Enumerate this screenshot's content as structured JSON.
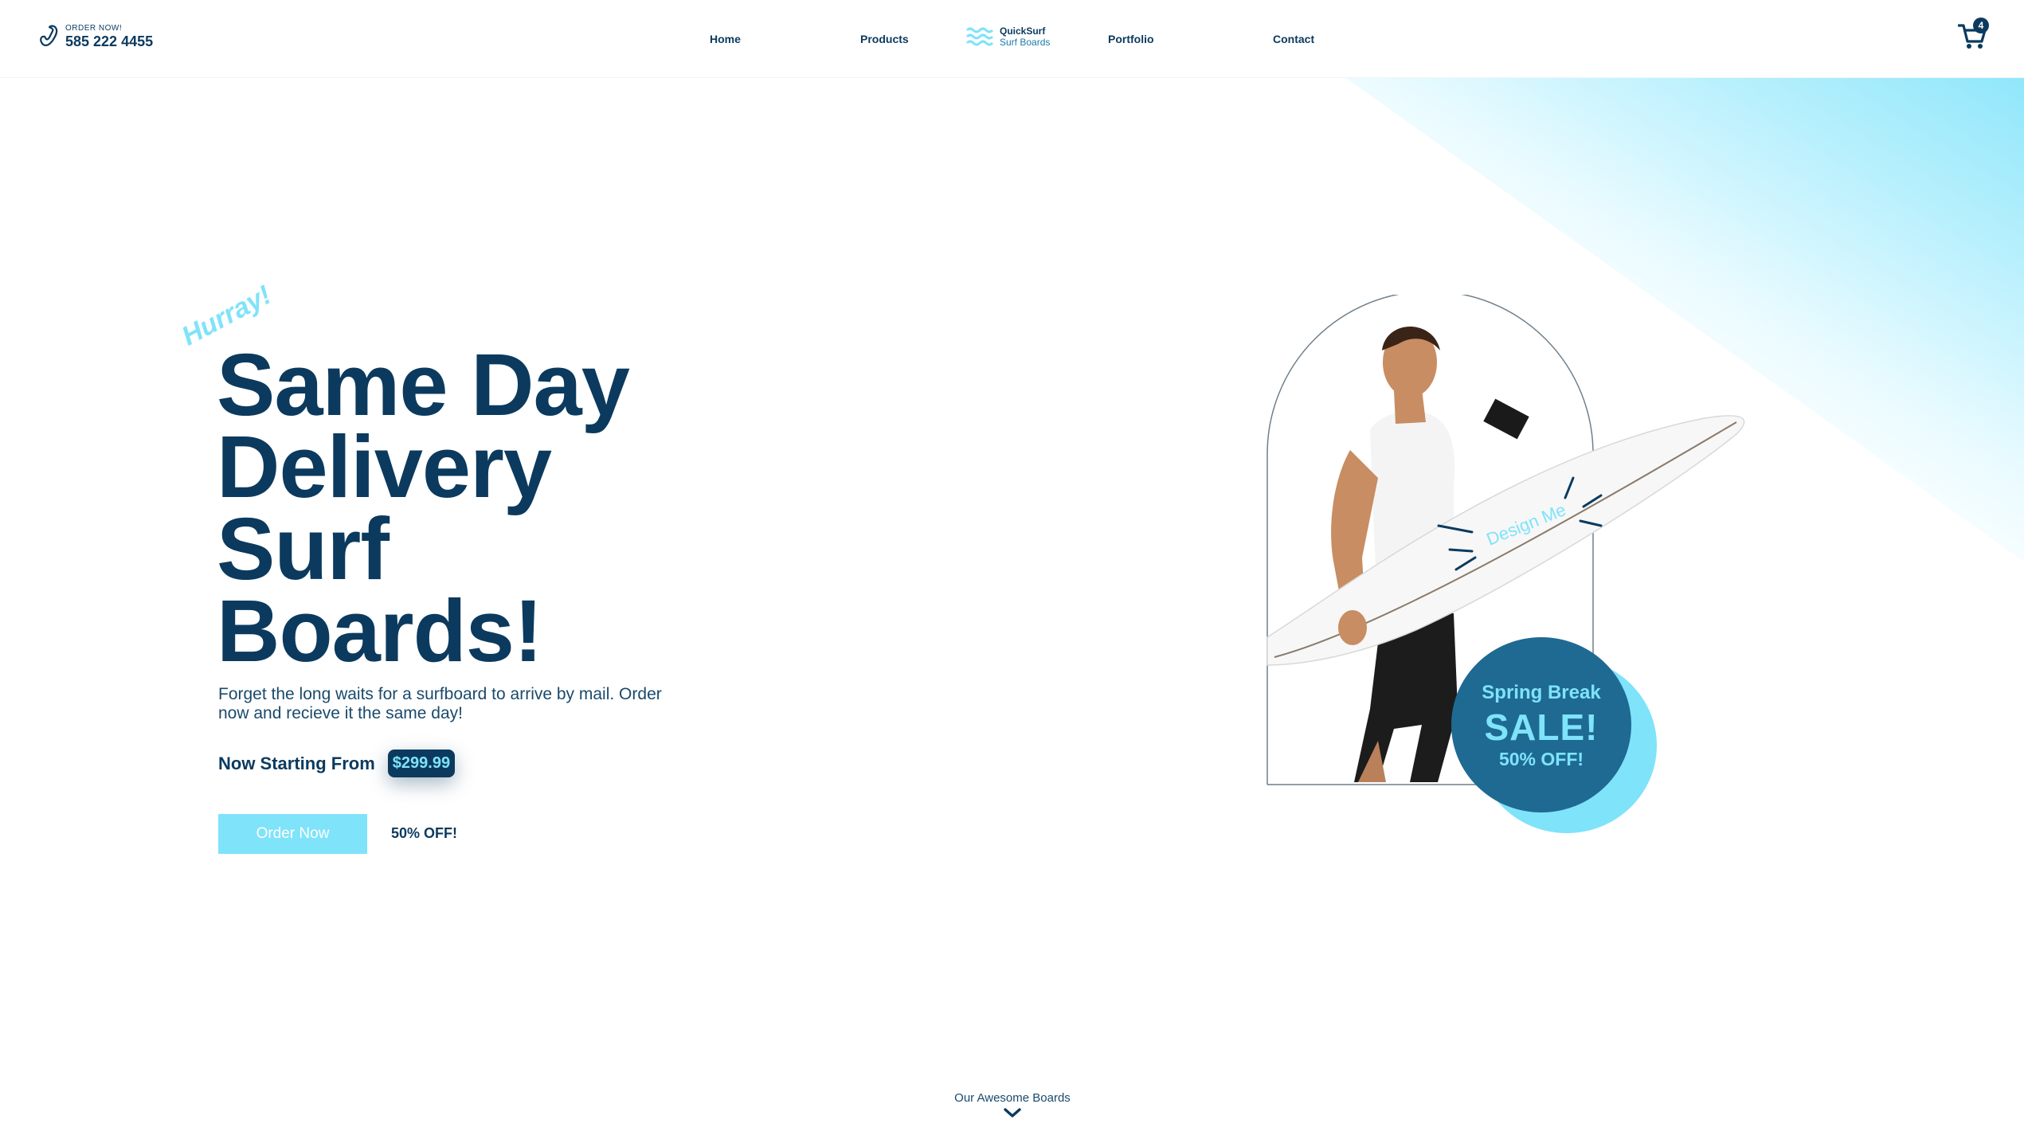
{
  "header": {
    "order_small": "ORDER NOW!",
    "order_phone": "585 222 4455",
    "nav": [
      "Home",
      "Products",
      "Portfolio",
      "Contact"
    ],
    "logo_line1": "QuickSurf",
    "logo_line2": "Surf Boards",
    "cart_count": "4"
  },
  "hero": {
    "hurray": "Hurray!",
    "headline": [
      "Same Day",
      "Delivery",
      "Surf",
      "Boards!"
    ],
    "description": "Forget the long waits for a surfboard to arrive by mail. Order now and recieve it the same day!",
    "price_label": "Now Starting From",
    "price": "$299.99",
    "cta": "Order Now",
    "off_label": "50% OFF!",
    "board_text": "Design Me"
  },
  "sale_badge": {
    "line1": "Spring Break",
    "line2": "SALE!",
    "line3": "50% OFF!"
  },
  "footer": {
    "scroll_label": "Our Awesome Boards"
  },
  "colors": {
    "primary": "#0b3a5e",
    "accent": "#7fe3fa",
    "badge": "#1e6a92"
  },
  "icons": [
    "phone-icon",
    "waves-logo-icon",
    "cart-icon",
    "chevron-down-icon"
  ]
}
